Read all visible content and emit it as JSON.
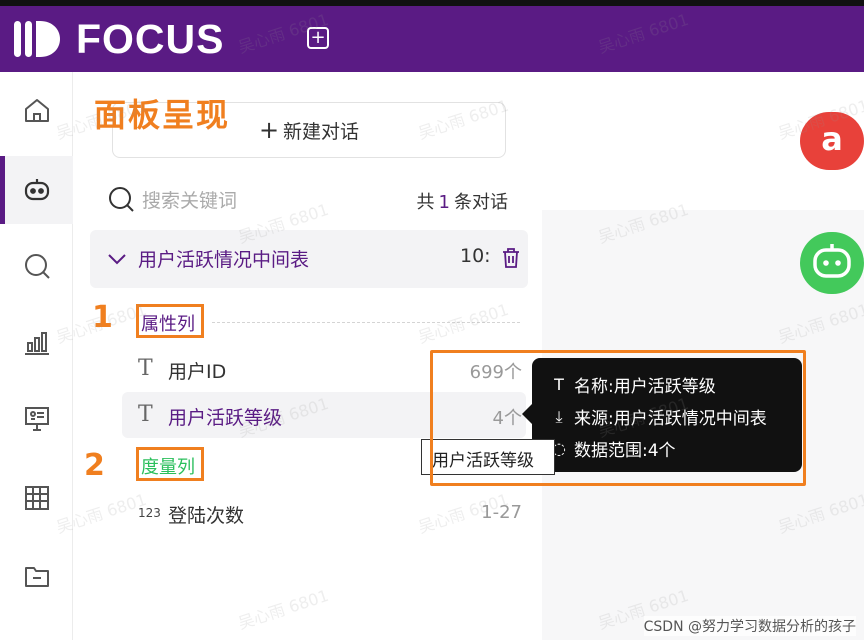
{
  "header": {
    "logo_text": "FOCUS",
    "new_tab_icon": "plus-square-icon",
    "brand_color": "#5a1b84"
  },
  "rail": {
    "items": [
      "home-icon",
      "robot-icon",
      "search-icon",
      "chart-icon",
      "presentation-icon",
      "grid-icon",
      "folder-icon"
    ],
    "active": "robot-icon"
  },
  "panel": {
    "annotation_title": "面板呈现",
    "new_chat_label": "新建对话",
    "search_placeholder": "搜索关键词",
    "conv_count_prefix": "共",
    "conv_count_value": "1",
    "conv_count_suffix": "条对话",
    "table_name": "用户活跃情况中间表",
    "table_time": "10:",
    "attr_section": "属性列",
    "measure_section": "度量列",
    "marker_1": "1",
    "marker_2": "2",
    "fields": [
      {
        "name": "用户ID",
        "count": "699个",
        "icon": "T"
      },
      {
        "name": "用户活跃等级",
        "count": "4个",
        "icon": "T"
      },
      {
        "name": "登陆次数",
        "count": "1-27",
        "icon": "123"
      }
    ]
  },
  "avatars": {
    "user_letter": "a",
    "user_color": "#e8413a",
    "bot_color": "#43c95b"
  },
  "tooltip": {
    "name_line": "名称:用户活跃等级",
    "source_line": "来源:用户活跃情况中间表",
    "range_line": "数据范围:4个",
    "hover_label": "用户活跃等级"
  },
  "watermark": "吴心雨 6801",
  "credit": "CSDN @努力学习数据分析的孩子"
}
